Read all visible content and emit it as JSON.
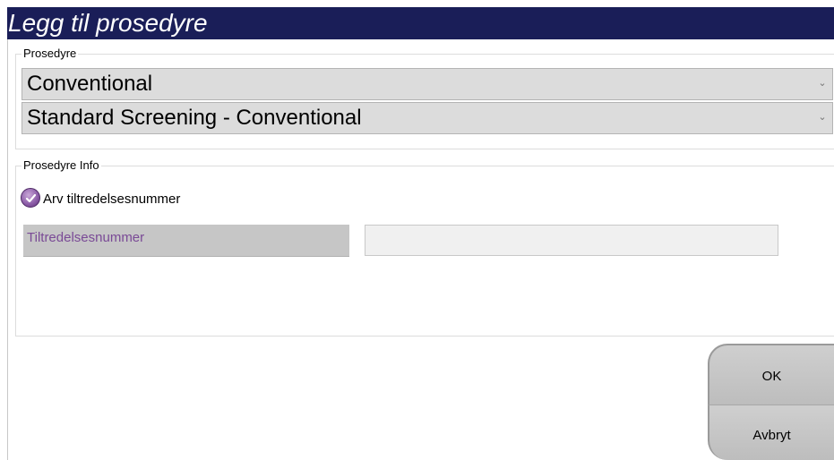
{
  "window": {
    "title": "Legg til prosedyre"
  },
  "procedure_group": {
    "legend": "Prosedyre",
    "select_1": {
      "value": "Conventional",
      "icon": "chevron-down-icon"
    },
    "select_2": {
      "value": "Standard Screening - Conventional",
      "icon": "chevron-down-icon"
    }
  },
  "info_group": {
    "legend": "Prosedyre Info",
    "inherit_checkbox": {
      "label": "Arv tiltredelsesnummer",
      "checked": true,
      "icon": "checkmark-icon"
    },
    "accession": {
      "label": "Tiltredelsesnummer",
      "value": ""
    }
  },
  "buttons": {
    "ok": "OK",
    "cancel": "Avbryt"
  },
  "colors": {
    "title_bar": "#1a1e58",
    "select_bg": "#dcdcdc",
    "accent_purple": "#8a5aa6",
    "accession_label_text": "#7a4a96"
  }
}
